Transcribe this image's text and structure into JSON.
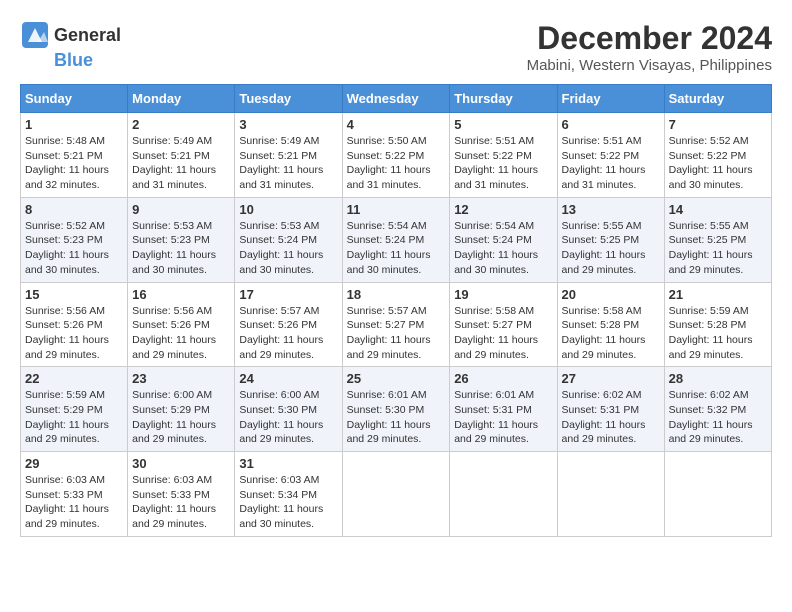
{
  "header": {
    "logo_general": "General",
    "logo_blue": "Blue",
    "title": "December 2024",
    "subtitle": "Mabini, Western Visayas, Philippines"
  },
  "calendar": {
    "days_of_week": [
      "Sunday",
      "Monday",
      "Tuesday",
      "Wednesday",
      "Thursday",
      "Friday",
      "Saturday"
    ],
    "weeks": [
      [
        {
          "day": "",
          "info": ""
        },
        {
          "day": "2",
          "info": "Sunrise: 5:49 AM\nSunset: 5:21 PM\nDaylight: 11 hours\nand 31 minutes."
        },
        {
          "day": "3",
          "info": "Sunrise: 5:49 AM\nSunset: 5:21 PM\nDaylight: 11 hours\nand 31 minutes."
        },
        {
          "day": "4",
          "info": "Sunrise: 5:50 AM\nSunset: 5:22 PM\nDaylight: 11 hours\nand 31 minutes."
        },
        {
          "day": "5",
          "info": "Sunrise: 5:51 AM\nSunset: 5:22 PM\nDaylight: 11 hours\nand 31 minutes."
        },
        {
          "day": "6",
          "info": "Sunrise: 5:51 AM\nSunset: 5:22 PM\nDaylight: 11 hours\nand 31 minutes."
        },
        {
          "day": "7",
          "info": "Sunrise: 5:52 AM\nSunset: 5:22 PM\nDaylight: 11 hours\nand 30 minutes."
        }
      ],
      [
        {
          "day": "1",
          "info": "Sunrise: 5:48 AM\nSunset: 5:21 PM\nDaylight: 11 hours\nand 32 minutes."
        },
        {
          "day": "",
          "info": ""
        },
        {
          "day": "",
          "info": ""
        },
        {
          "day": "",
          "info": ""
        },
        {
          "day": "",
          "info": ""
        },
        {
          "day": "",
          "info": ""
        },
        {
          "day": ""
        }
      ],
      [
        {
          "day": "8",
          "info": "Sunrise: 5:52 AM\nSunset: 5:23 PM\nDaylight: 11 hours\nand 30 minutes."
        },
        {
          "day": "9",
          "info": "Sunrise: 5:53 AM\nSunset: 5:23 PM\nDaylight: 11 hours\nand 30 minutes."
        },
        {
          "day": "10",
          "info": "Sunrise: 5:53 AM\nSunset: 5:24 PM\nDaylight: 11 hours\nand 30 minutes."
        },
        {
          "day": "11",
          "info": "Sunrise: 5:54 AM\nSunset: 5:24 PM\nDaylight: 11 hours\nand 30 minutes."
        },
        {
          "day": "12",
          "info": "Sunrise: 5:54 AM\nSunset: 5:24 PM\nDaylight: 11 hours\nand 30 minutes."
        },
        {
          "day": "13",
          "info": "Sunrise: 5:55 AM\nSunset: 5:25 PM\nDaylight: 11 hours\nand 29 minutes."
        },
        {
          "day": "14",
          "info": "Sunrise: 5:55 AM\nSunset: 5:25 PM\nDaylight: 11 hours\nand 29 minutes."
        }
      ],
      [
        {
          "day": "15",
          "info": "Sunrise: 5:56 AM\nSunset: 5:26 PM\nDaylight: 11 hours\nand 29 minutes."
        },
        {
          "day": "16",
          "info": "Sunrise: 5:56 AM\nSunset: 5:26 PM\nDaylight: 11 hours\nand 29 minutes."
        },
        {
          "day": "17",
          "info": "Sunrise: 5:57 AM\nSunset: 5:26 PM\nDaylight: 11 hours\nand 29 minutes."
        },
        {
          "day": "18",
          "info": "Sunrise: 5:57 AM\nSunset: 5:27 PM\nDaylight: 11 hours\nand 29 minutes."
        },
        {
          "day": "19",
          "info": "Sunrise: 5:58 AM\nSunset: 5:27 PM\nDaylight: 11 hours\nand 29 minutes."
        },
        {
          "day": "20",
          "info": "Sunrise: 5:58 AM\nSunset: 5:28 PM\nDaylight: 11 hours\nand 29 minutes."
        },
        {
          "day": "21",
          "info": "Sunrise: 5:59 AM\nSunset: 5:28 PM\nDaylight: 11 hours\nand 29 minutes."
        }
      ],
      [
        {
          "day": "22",
          "info": "Sunrise: 5:59 AM\nSunset: 5:29 PM\nDaylight: 11 hours\nand 29 minutes."
        },
        {
          "day": "23",
          "info": "Sunrise: 6:00 AM\nSunset: 5:29 PM\nDaylight: 11 hours\nand 29 minutes."
        },
        {
          "day": "24",
          "info": "Sunrise: 6:00 AM\nSunset: 5:30 PM\nDaylight: 11 hours\nand 29 minutes."
        },
        {
          "day": "25",
          "info": "Sunrise: 6:01 AM\nSunset: 5:30 PM\nDaylight: 11 hours\nand 29 minutes."
        },
        {
          "day": "26",
          "info": "Sunrise: 6:01 AM\nSunset: 5:31 PM\nDaylight: 11 hours\nand 29 minutes."
        },
        {
          "day": "27",
          "info": "Sunrise: 6:02 AM\nSunset: 5:31 PM\nDaylight: 11 hours\nand 29 minutes."
        },
        {
          "day": "28",
          "info": "Sunrise: 6:02 AM\nSunset: 5:32 PM\nDaylight: 11 hours\nand 29 minutes."
        }
      ],
      [
        {
          "day": "29",
          "info": "Sunrise: 6:03 AM\nSunset: 5:33 PM\nDaylight: 11 hours\nand 29 minutes."
        },
        {
          "day": "30",
          "info": "Sunrise: 6:03 AM\nSunset: 5:33 PM\nDaylight: 11 hours\nand 29 minutes."
        },
        {
          "day": "31",
          "info": "Sunrise: 6:03 AM\nSunset: 5:34 PM\nDaylight: 11 hours\nand 30 minutes."
        },
        {
          "day": "",
          "info": ""
        },
        {
          "day": "",
          "info": ""
        },
        {
          "day": "",
          "info": ""
        },
        {
          "day": "",
          "info": ""
        }
      ]
    ]
  }
}
